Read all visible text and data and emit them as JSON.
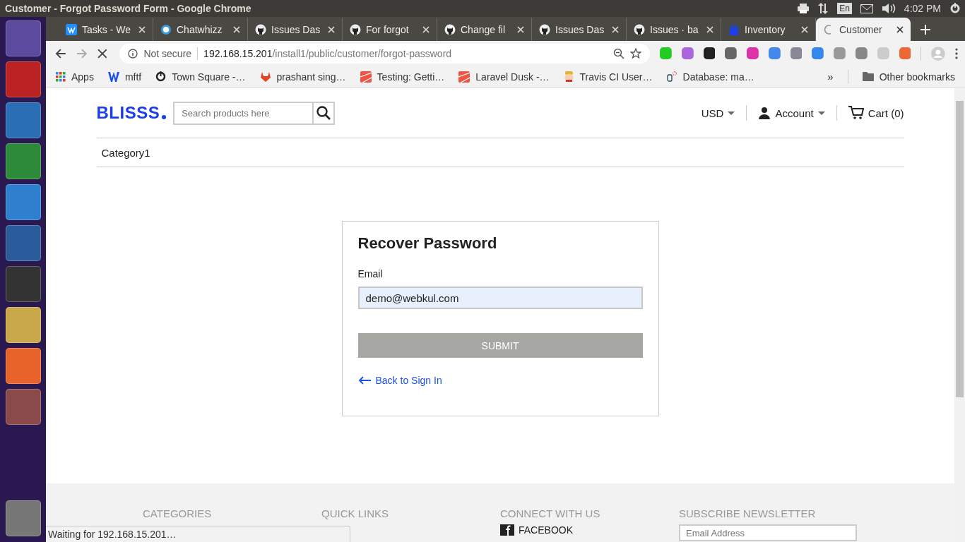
{
  "system_bar": {
    "window_title": "Customer - Forgot Password Form - Google Chrome",
    "keyboard": "En",
    "time": "4:02 PM"
  },
  "tabs": [
    {
      "title": "Tasks - We",
      "kind": "tasks",
      "selected": false
    },
    {
      "title": "Chatwhizz",
      "kind": "chat",
      "selected": false
    },
    {
      "title": "Issues Das",
      "kind": "github",
      "selected": false
    },
    {
      "title": "For forgot",
      "kind": "github",
      "selected": false
    },
    {
      "title": "Change fil",
      "kind": "github",
      "selected": false
    },
    {
      "title": "Issues Das",
      "kind": "github",
      "selected": false
    },
    {
      "title": "Issues · ba",
      "kind": "github",
      "selected": false
    },
    {
      "title": "Inventory",
      "kind": "bag",
      "selected": false
    },
    {
      "title": "Customer",
      "kind": "loading",
      "selected": true
    }
  ],
  "address_bar": {
    "security": "Not secure",
    "host": "192.168.15.201",
    "path": "/install1/public/customer/forgot-password"
  },
  "bookmarks": [
    {
      "label": "Apps",
      "kind": "apps"
    },
    {
      "label": "mftf",
      "kind": "w"
    },
    {
      "label": "Town Square -…",
      "kind": "ring"
    },
    {
      "label": "prashant sing…",
      "kind": "fox"
    },
    {
      "label": "Testing: Getti…",
      "kind": "red"
    },
    {
      "label": "Laravel Dusk -…",
      "kind": "red"
    },
    {
      "label": "Travis CI User…",
      "kind": "face"
    },
    {
      "label": "Database: ma…",
      "kind": "db"
    }
  ],
  "bookmarks_more": "»",
  "other_bookmarks": "Other bookmarks",
  "shop": {
    "logo": "BLISSS",
    "search_placeholder": "Search products here",
    "currency": "USD",
    "account": "Account",
    "cart": "Cart (0)",
    "categories": [
      {
        "label": "Category1"
      }
    ]
  },
  "form": {
    "title": "Recover Password",
    "email_label": "Email",
    "email_value": "demo@webkul.com",
    "submit": "SUBMIT",
    "back_link": "Back to Sign In"
  },
  "footer": {
    "columns": [
      {
        "heading": "CATEGORIES"
      },
      {
        "heading": "QUICK LINKS"
      },
      {
        "heading": "CONNECT WITH US",
        "link": "FACEBOOK"
      },
      {
        "heading": "SUBSCRIBE NEWSLETTER",
        "placeholder": "Email Address"
      }
    ]
  },
  "status_bubble": "Waiting for 192.168.15.201…"
}
